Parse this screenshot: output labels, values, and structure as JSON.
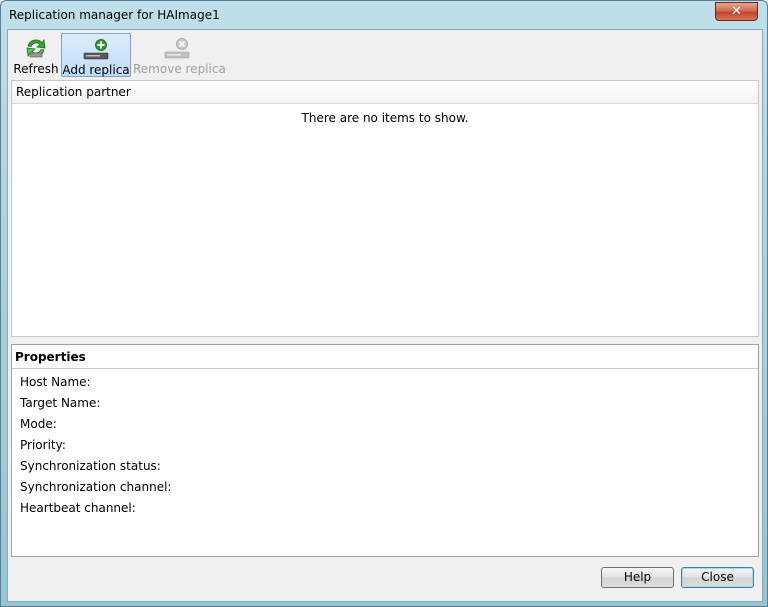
{
  "window": {
    "title": "Replication manager for HAImage1",
    "close_glyph": "✕"
  },
  "toolbar": {
    "refresh_label": "Refresh",
    "add_replica_label": "Add replica",
    "remove_replica_label": "Remove replica"
  },
  "list": {
    "column_header": "Replication partner",
    "empty_message": "There are no items to show."
  },
  "properties": {
    "title": "Properties",
    "rows": [
      "Host Name:",
      "Target Name:",
      "Mode:",
      "Priority:",
      "Synchronization status:",
      "Synchronization channel:",
      "Heartbeat channel:"
    ]
  },
  "buttons": {
    "help_label": "Help",
    "close_label": "Close"
  },
  "colors": {
    "accent": "#c1dcfa",
    "refresh_icon_green": "#3aa23a",
    "add_icon_green": "#2e9a2e"
  },
  "icons": {
    "refresh": "refresh-icon",
    "add_replica": "add-replica-icon",
    "remove_replica": "remove-replica-icon"
  }
}
